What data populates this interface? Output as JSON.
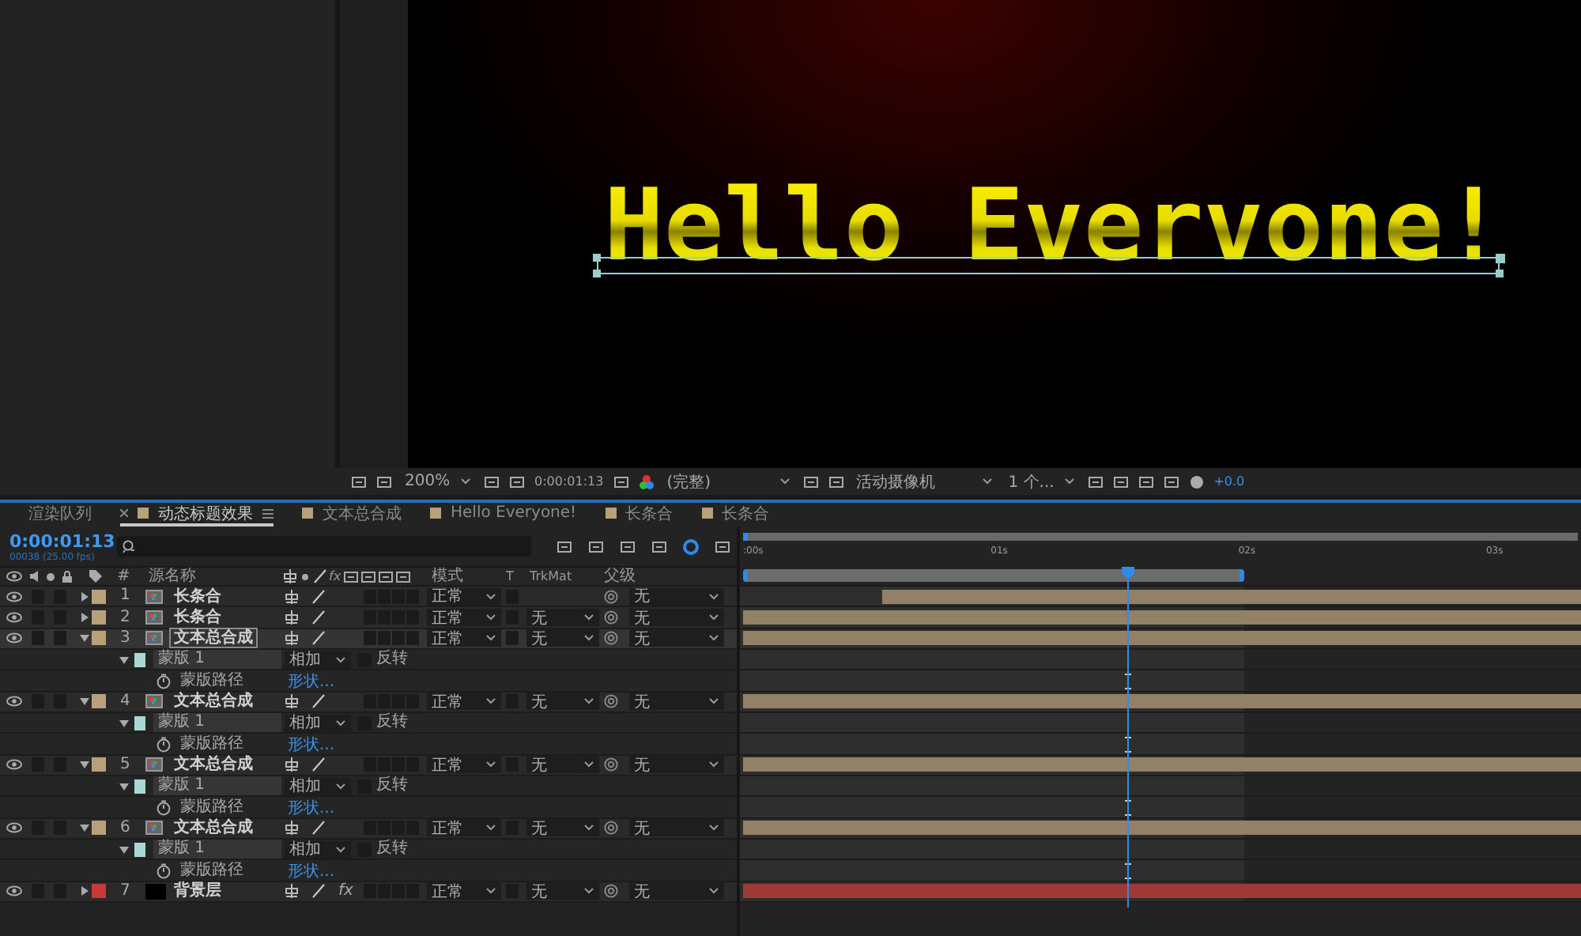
{
  "viewer": {
    "text": "Hello Evervone!"
  },
  "viewer_toolbar": {
    "zoom": "200%",
    "timecode": "0:00:01:13",
    "resolution": "(完整)",
    "camera": "活动摄像机",
    "views": "1 个...",
    "exposure": "+0.0"
  },
  "tabs": [
    {
      "label": "渲染队列",
      "selected": false
    },
    {
      "label": "动态标题效果",
      "selected": true,
      "color": "#b8a07a"
    },
    {
      "label": "文本总合成",
      "selected": false,
      "color": "#b8a07a"
    },
    {
      "label": "Hello Everyone!",
      "selected": false,
      "color": "#b8a07a"
    },
    {
      "label": "长条合",
      "selected": false,
      "color": "#b8a07a"
    },
    {
      "label": "长条合",
      "selected": false,
      "color": "#b8a07a"
    }
  ],
  "timeline": {
    "timecode": "0:00:01:13",
    "frame_info": "00038 (25.00 fps)"
  },
  "columns": {
    "number": "#",
    "source_name": "源名称",
    "fx": "fx",
    "mode": "模式",
    "t": "T",
    "trkmat": "TrkMat",
    "parent": "父级"
  },
  "ruler": {
    "ticks": [
      ":00s",
      "01s",
      "02s",
      "03s"
    ]
  },
  "playhead": {
    "level": 0.46
  },
  "work_area": {
    "level": 0.6
  },
  "layers": [
    {
      "number": "1",
      "name": "长条合",
      "kind": "comp",
      "color": "#b8a07a",
      "expanded": false,
      "selected": false,
      "mode": "正常",
      "parent": "无",
      "trimmed": true
    },
    {
      "number": "2",
      "name": "长条合",
      "kind": "comp",
      "color": "#b8a07a",
      "expanded": false,
      "selected": false,
      "mode": "正常",
      "trkmat": "无",
      "parent": "无",
      "trimmed": false
    },
    {
      "number": "3",
      "name": "文本总合成",
      "kind": "comp",
      "color": "#b8a07a",
      "expanded": true,
      "selected": true,
      "mode": "正常",
      "trkmat": "无",
      "parent": "无",
      "trimmed": false,
      "masks": [
        {
          "name": "蒙版 1",
          "mode": "相加",
          "invert": "反转",
          "inverted": false,
          "color": "#a9d8d6",
          "expanded": true,
          "path": {
            "name": "蒙版路径",
            "value": "形状...",
            "keyframe": true
          }
        }
      ]
    },
    {
      "number": "4",
      "name": "文本总合成",
      "kind": "comp",
      "color": "#b8a07a",
      "expanded": true,
      "selected": false,
      "mode": "正常",
      "trkmat": "无",
      "parent": "无",
      "trimmed": false,
      "masks": [
        {
          "name": "蒙版 1",
          "mode": "相加",
          "invert": "反转",
          "inverted": false,
          "color": "#a9d8d6",
          "expanded": true,
          "path": {
            "name": "蒙版路径",
            "value": "形状...",
            "keyframe": true
          }
        }
      ]
    },
    {
      "number": "5",
      "name": "文本总合成",
      "kind": "comp",
      "color": "#b8a07a",
      "expanded": true,
      "selected": false,
      "mode": "正常",
      "trkmat": "无",
      "parent": "无",
      "trimmed": false,
      "masks": [
        {
          "name": "蒙版 1",
          "mode": "相加",
          "invert": "反转",
          "inverted": false,
          "color": "#a9d8d6",
          "expanded": true,
          "path": {
            "name": "蒙版路径",
            "value": "形状...",
            "keyframe": true
          }
        }
      ]
    },
    {
      "number": "6",
      "name": "文本总合成",
      "kind": "comp",
      "color": "#b8a07a",
      "expanded": true,
      "selected": false,
      "mode": "正常",
      "trkmat": "无",
      "parent": "无",
      "trimmed": false,
      "masks": [
        {
          "name": "蒙版 1",
          "mode": "相加",
          "invert": "反转",
          "inverted": false,
          "color": "#a9d8d6",
          "expanded": true,
          "path": {
            "name": "蒙版路径",
            "value": "形状...",
            "keyframe": true
          }
        }
      ]
    },
    {
      "number": "7",
      "name": "背景层",
      "kind": "solid",
      "color": "#c83a36",
      "expanded": false,
      "selected": false,
      "mode": "正常",
      "trkmat": "无",
      "parent": "无",
      "effects": "fx",
      "trimmed": false
    }
  ]
}
